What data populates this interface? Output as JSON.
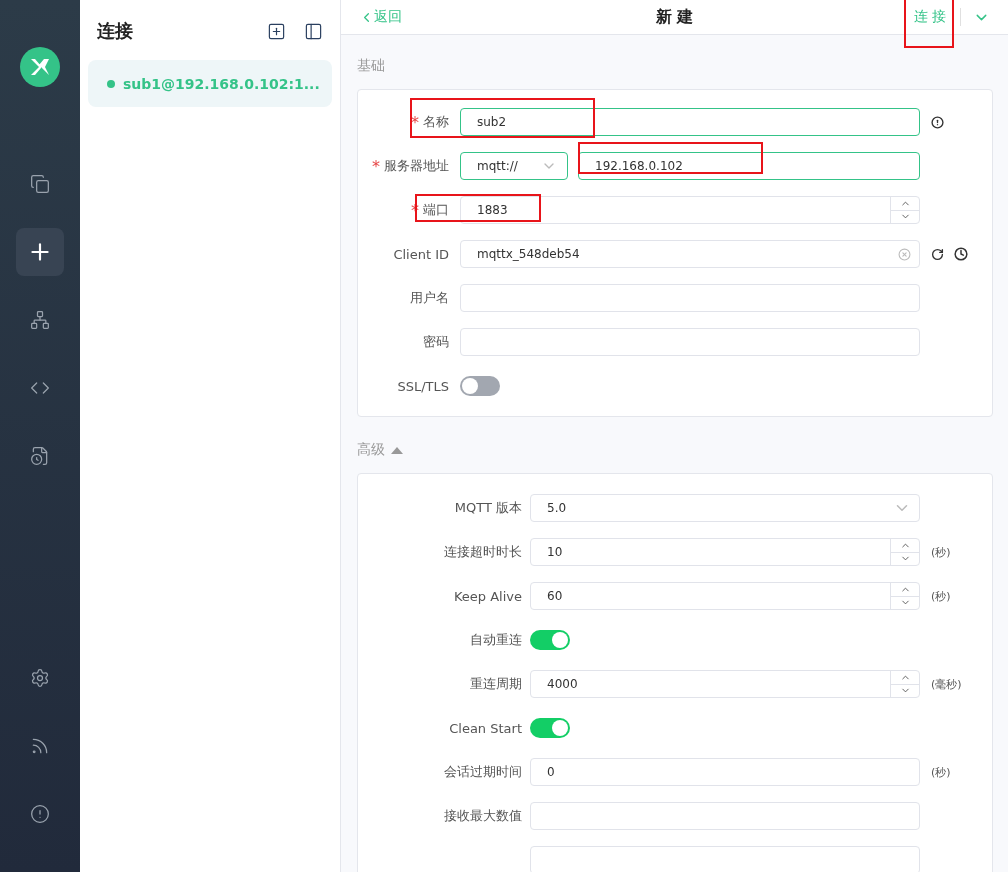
{
  "nav": {
    "items": [
      {
        "selected": false
      },
      {
        "selected": true
      },
      {
        "selected": false
      },
      {
        "selected": false
      },
      {
        "selected": false
      }
    ],
    "bottom_items": [
      {
        "selected": false
      },
      {
        "selected": false
      },
      {
        "selected": false
      }
    ]
  },
  "connections": {
    "title": "连接",
    "items": [
      {
        "name": "sub1@192.168.0.102:1...",
        "selected": true,
        "color": "#34c388"
      }
    ]
  },
  "header": {
    "back": "返回",
    "title": "新 建",
    "connect": "连 接",
    "connect_highlighted": true
  },
  "basic": {
    "title": "基础",
    "fields": [
      {
        "kind": "text",
        "required_mark": "*",
        "label": "名称",
        "value": "sub2",
        "active": true,
        "highlighted": true
      },
      {
        "kind": "address",
        "required_mark": "*",
        "label": "服务器地址",
        "protocol": "mqtt://",
        "value": "192.168.0.102",
        "active": true,
        "highlighted": true
      },
      {
        "kind": "number",
        "required_mark": "*",
        "label": "端口",
        "value": "1883",
        "active": false,
        "highlighted": true
      },
      {
        "kind": "clientid",
        "label": "Client ID",
        "value": "mqttx_548deb54",
        "active": false
      },
      {
        "kind": "text",
        "label": "用户名",
        "active": false
      },
      {
        "kind": "text",
        "label": "密码",
        "active": false
      },
      {
        "kind": "toggle",
        "label": "SSL/TLS",
        "on": false
      }
    ]
  },
  "advanced": {
    "title": "高级",
    "expanded": true,
    "fields": [
      {
        "kind": "select",
        "label": "MQTT 版本",
        "value": "5.0"
      },
      {
        "kind": "number",
        "label": "连接超时时长",
        "value": "10",
        "unit": "(秒)"
      },
      {
        "kind": "number",
        "label": "Keep Alive",
        "value": "60",
        "unit": "(秒)"
      },
      {
        "kind": "toggle",
        "label": "自动重连",
        "on": true
      },
      {
        "kind": "number",
        "label": "重连周期",
        "value": "4000",
        "unit": "(毫秒)"
      },
      {
        "kind": "toggle",
        "label": "Clean Start",
        "on": true
      },
      {
        "kind": "text",
        "label": "会话过期时间",
        "value": "0",
        "unit": "(秒)"
      },
      {
        "kind": "text",
        "label": "接收最大数值"
      },
      {
        "kind": "text"
      }
    ]
  }
}
